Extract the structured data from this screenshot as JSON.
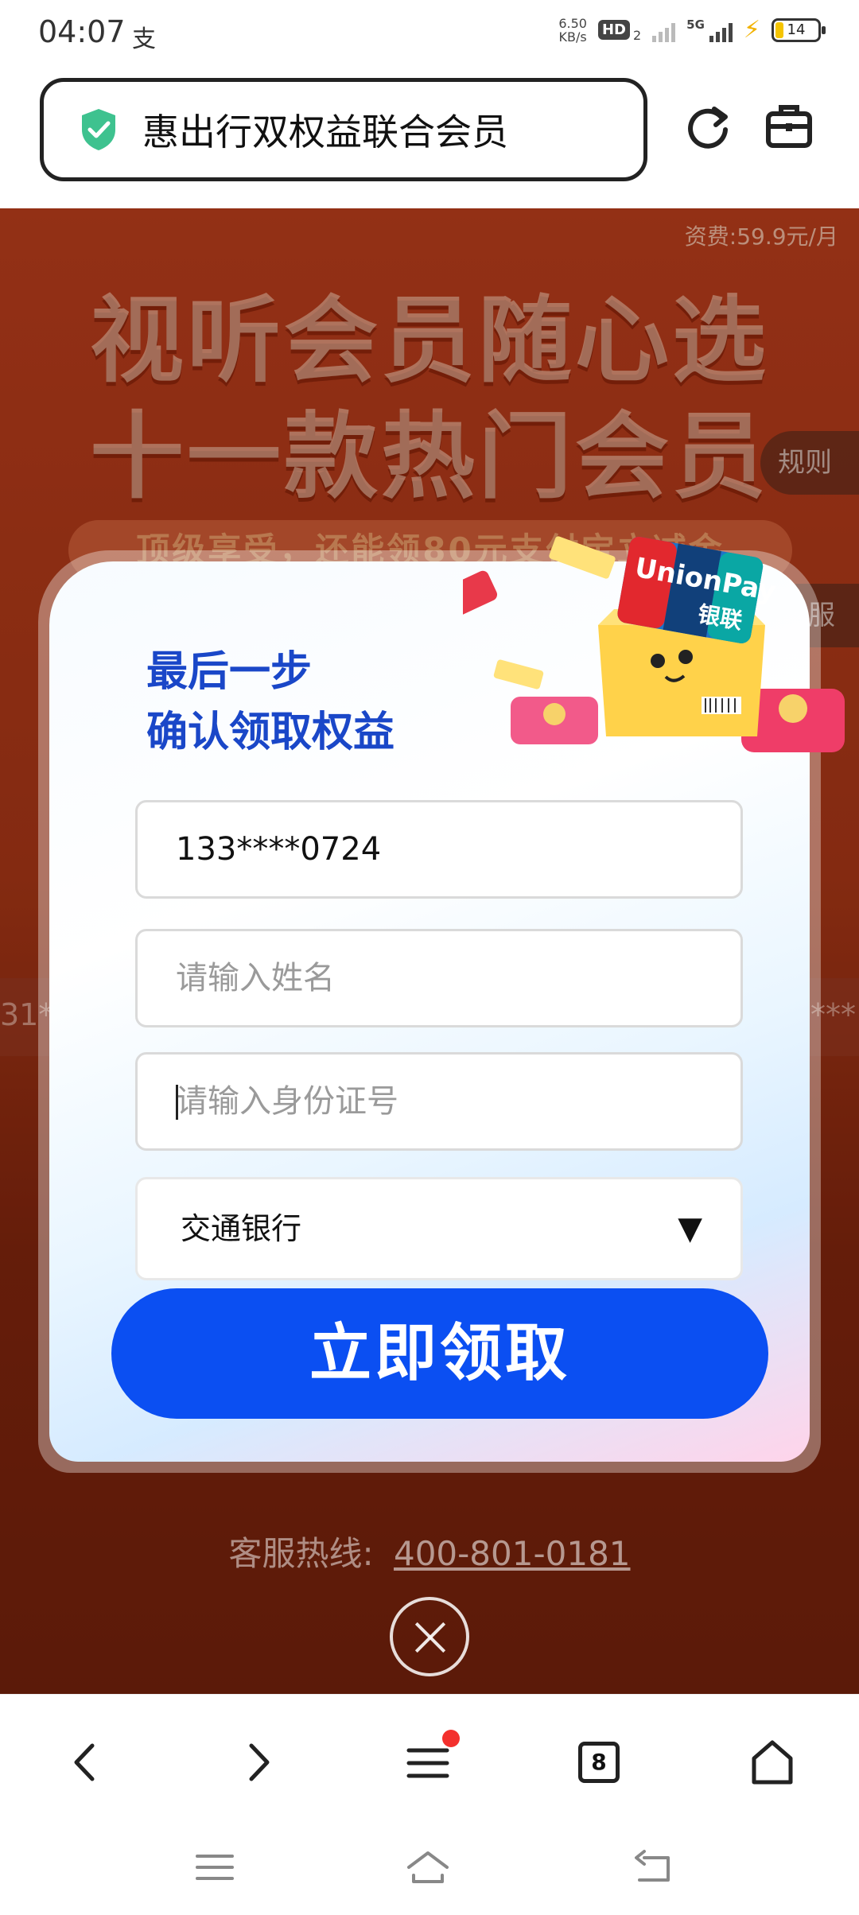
{
  "status_bar": {
    "time": "04:07",
    "app_icon_text": "支",
    "net_speed_value": "6.50",
    "net_speed_unit": "KB/s",
    "hd_label": "HD",
    "hd_sub": "2",
    "network": "5G",
    "battery": "14"
  },
  "url_bar": {
    "title": "惠出行双权益联合会员"
  },
  "page": {
    "fee_text": "资费:59.9元/月",
    "banner_line1": "视听会员随心选",
    "banner_line2": "十一款热门会员",
    "banner_sub": "顶级享受，还能领80元支付宝立减金",
    "rules_tab": "规则",
    "service_tab": "服",
    "marquee_left": "31**",
    "marquee_right": "***"
  },
  "dialog": {
    "title_line1": "最后一步",
    "title_line2": "确认领取权益",
    "phone_value": "133****0724",
    "name_placeholder": "请输入姓名",
    "id_placeholder": "请输入身份证号",
    "bank_selected": "交通银行",
    "submit_label": "立即领取",
    "illustration_brand": "UnionPay",
    "illustration_brand_cn": "银联"
  },
  "footer": {
    "hotline_label": "客服热线:",
    "hotline_number": "400-801-0181"
  },
  "bottom_nav": {
    "tab_count": "8"
  },
  "colors": {
    "primary_button": "#0b4ff2",
    "title_blue": "#1a47c8",
    "shield_green": "#3ec28f"
  }
}
